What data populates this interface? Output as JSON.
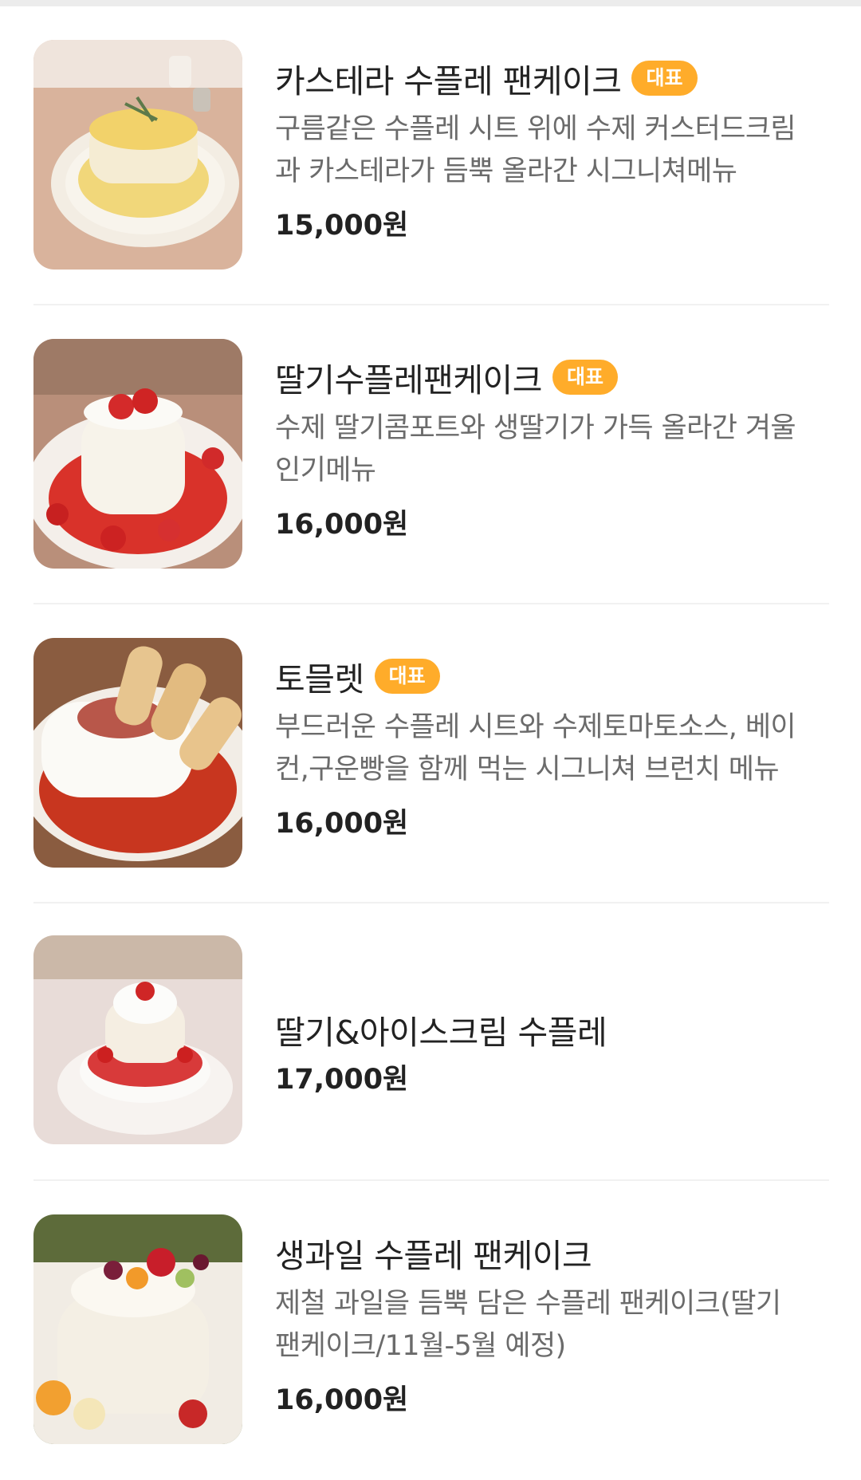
{
  "items": [
    {
      "name": "카스테라 수플레 팬케이크",
      "badge": "대표",
      "desc_line1": "구름같은 수플레 시트 위에 수제 커스터드크림",
      "desc_line2": "과 카스테라가 듬뿍 올라간 시그니쳐메뉴",
      "price": "15,000원",
      "image": "castella-souffle-pancake-photo"
    },
    {
      "name": "딸기수플레팬케이크",
      "badge": "대표",
      "desc_line1": "수제 딸기콤포트와 생딸기가 가득 올라간 겨울",
      "desc_line2": "인기메뉴",
      "price": "16,000원",
      "image": "strawberry-souffle-pancake-photo"
    },
    {
      "name": "토믈렛",
      "badge": "대표",
      "desc_line1": "부드러운 수플레 시트와 수제토마토소스, 베이",
      "desc_line2": "컨,구운빵을 함께 먹는 시그니쳐 브런치 메뉴",
      "price": "16,000원",
      "image": "tomelette-photo"
    },
    {
      "name": "딸기&아이스크림 수플레",
      "price": "17,000원",
      "image": "strawberry-icecream-souffle-photo"
    },
    {
      "name": "생과일 수플레 팬케이크",
      "desc_line1": "제철 과일을 듬뿍 담은 수플레 팬케이크(딸기",
      "desc_line2": "팬케이크/11월-5월 예정)",
      "price": "16,000원",
      "image": "fresh-fruit-souffle-pancake-photo"
    }
  ],
  "colors": {
    "badge": "#ffac2a",
    "title": "#222222",
    "description": "#6b6b6b",
    "divider": "#f1f1f1"
  }
}
